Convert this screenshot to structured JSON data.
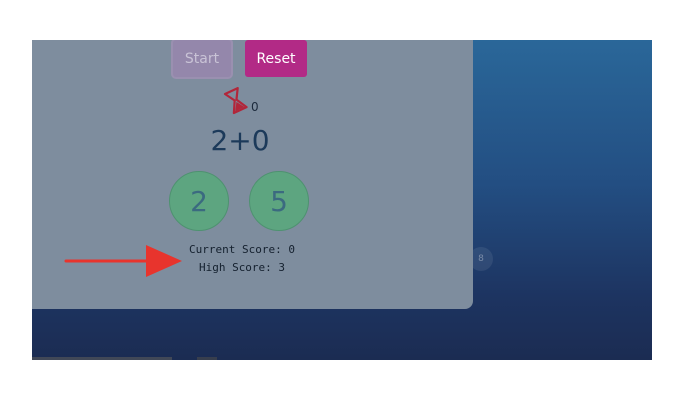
{
  "controls": {
    "start_label": "Start",
    "reset_label": "Reset"
  },
  "timer": {
    "value": "0"
  },
  "problem": {
    "expression": "2+0"
  },
  "answers": [
    "2",
    "5"
  ],
  "scores": {
    "current": "Current Score: 0",
    "high": "High Score: 3"
  },
  "background_bubbles": [
    "0",
    "8"
  ],
  "colors": {
    "panel": "#7e8d9e",
    "start_button": "#9487ab",
    "reset_button": "#b22a86",
    "answer_bubble": "#5da580",
    "arrow": "#e8342d",
    "timer_icon": "#b2263a",
    "background_top": "#2a6799",
    "background_bottom": "#1b2c52"
  }
}
